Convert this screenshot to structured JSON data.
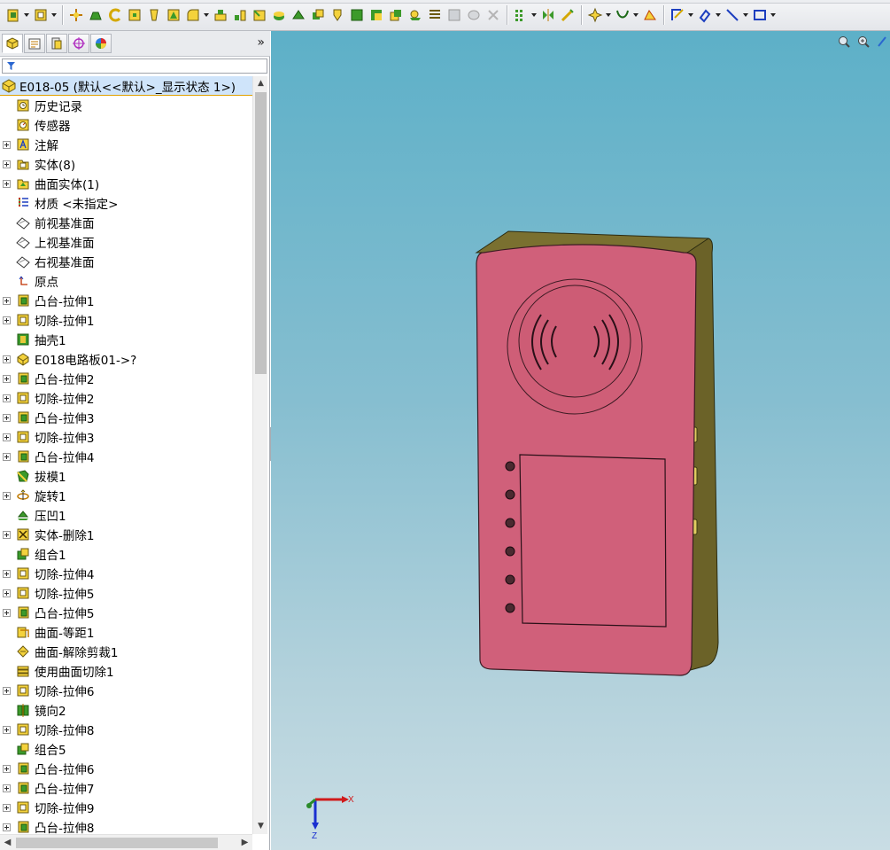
{
  "toolbar": {
    "icons": [
      "new-part-icon",
      "open-icon",
      "move-icon",
      "extrude-icon",
      "revolve-icon",
      "sweep-icon",
      "loft-icon",
      "boundary-icon",
      "fillet-icon",
      "linear-pattern-icon",
      "rib-icon",
      "draft-icon",
      "shell-icon",
      "wrap-icon",
      "intersect-icon",
      "reference-geometry-icon",
      "curves-icon",
      "instant3d-icon",
      "sketch-icon",
      "smart-dimension-icon",
      "line-icon",
      "rectangle-icon"
    ]
  },
  "feature_manager": {
    "root_label": "E018-05  (默认<<默认>_显示状态 1>)",
    "items": [
      {
        "label": "历史记录",
        "icon": "history-icon",
        "expandable": false
      },
      {
        "label": "传感器",
        "icon": "sensor-icon",
        "expandable": false
      },
      {
        "label": "注解",
        "icon": "annotation-icon",
        "expandable": true
      },
      {
        "label": "实体(8)",
        "icon": "solid-bodies-icon",
        "expandable": true
      },
      {
        "label": "曲面实体(1)",
        "icon": "surface-bodies-icon",
        "expandable": true
      },
      {
        "label": "材质 <未指定>",
        "icon": "material-icon",
        "expandable": false
      },
      {
        "label": "前视基准面",
        "icon": "plane-icon",
        "expandable": false
      },
      {
        "label": "上视基准面",
        "icon": "plane-icon",
        "expandable": false
      },
      {
        "label": "右视基准面",
        "icon": "plane-icon",
        "expandable": false
      },
      {
        "label": "原点",
        "icon": "origin-icon",
        "expandable": false
      },
      {
        "label": "凸台-拉伸1",
        "icon": "boss-extrude-icon",
        "expandable": true
      },
      {
        "label": "切除-拉伸1",
        "icon": "cut-extrude-icon",
        "expandable": true
      },
      {
        "label": "抽壳1",
        "icon": "shell-icon",
        "expandable": false
      },
      {
        "label": "E018电路板01->?",
        "icon": "part-icon",
        "expandable": true
      },
      {
        "label": "凸台-拉伸2",
        "icon": "boss-extrude-icon",
        "expandable": true
      },
      {
        "label": "切除-拉伸2",
        "icon": "cut-extrude-icon",
        "expandable": true
      },
      {
        "label": "凸台-拉伸3",
        "icon": "boss-extrude-icon",
        "expandable": true
      },
      {
        "label": "切除-拉伸3",
        "icon": "cut-extrude-icon",
        "expandable": true
      },
      {
        "label": "凸台-拉伸4",
        "icon": "boss-extrude-icon",
        "expandable": true
      },
      {
        "label": "拔模1",
        "icon": "draft-icon",
        "expandable": false
      },
      {
        "label": "旋转1",
        "icon": "revolve-icon",
        "expandable": true
      },
      {
        "label": "压凹1",
        "icon": "indent-icon",
        "expandable": false
      },
      {
        "label": "实体-删除1",
        "icon": "delete-body-icon",
        "expandable": true
      },
      {
        "label": "组合1",
        "icon": "combine-icon",
        "expandable": false
      },
      {
        "label": "切除-拉伸4",
        "icon": "cut-extrude-icon",
        "expandable": true
      },
      {
        "label": "切除-拉伸5",
        "icon": "cut-extrude-icon",
        "expandable": true
      },
      {
        "label": "凸台-拉伸5",
        "icon": "boss-extrude-icon",
        "expandable": true
      },
      {
        "label": "曲面-等距1",
        "icon": "offset-surface-icon",
        "expandable": false
      },
      {
        "label": "曲面-解除剪裁1",
        "icon": "untrim-surface-icon",
        "expandable": false
      },
      {
        "label": "使用曲面切除1",
        "icon": "surface-cut-icon",
        "expandable": false
      },
      {
        "label": "切除-拉伸6",
        "icon": "cut-extrude-icon",
        "expandable": true
      },
      {
        "label": "镜向2",
        "icon": "mirror-icon",
        "expandable": false
      },
      {
        "label": "切除-拉伸8",
        "icon": "cut-extrude-icon",
        "expandable": true
      },
      {
        "label": "组合5",
        "icon": "combine-icon",
        "expandable": false
      },
      {
        "label": "凸台-拉伸6",
        "icon": "boss-extrude-icon",
        "expandable": true
      },
      {
        "label": "凸台-拉伸7",
        "icon": "boss-extrude-icon",
        "expandable": true
      },
      {
        "label": "切除-拉伸9",
        "icon": "cut-extrude-icon",
        "expandable": true
      },
      {
        "label": "凸台-拉伸8",
        "icon": "boss-extrude-icon",
        "expandable": true
      }
    ]
  },
  "viewport": {
    "model_colors": {
      "front": "#d0607a",
      "side": "#6b6228",
      "top": "#7a7030"
    },
    "triad": {
      "x_label": "X",
      "z_label": "Z"
    }
  }
}
